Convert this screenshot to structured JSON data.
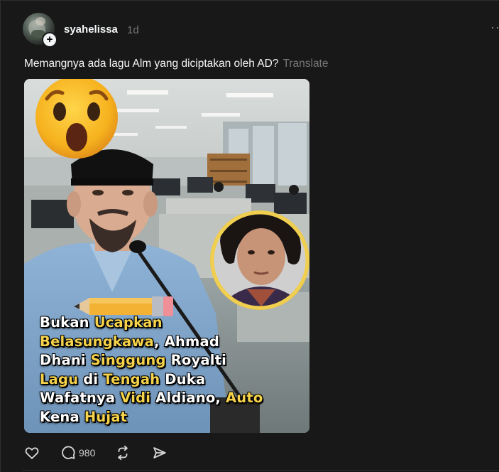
{
  "post": {
    "username": "syahelissa",
    "timestamp": "1d",
    "follow_icon": "plus",
    "more_icon": "ellipsis",
    "text": "Memangnya ada lagu Alm yang diciptakan oleh AD?",
    "translate_label": "Translate"
  },
  "media": {
    "headline": {
      "line1_a": "Bukan ",
      "line1_b": "Ucapkan",
      "line2_a": "Belasungkawa",
      "line2_b": ", Ahmad",
      "line3_a": "Dhani ",
      "line3_b": "Singgung",
      "line3_c": " Royalti",
      "line4_a": "Lagu",
      "line4_b": " di ",
      "line4_c": "Tengah",
      "line4_d": " Duka",
      "line5_a": "Wafatnya ",
      "line5_b": "Vidi",
      "line5_c": " Aldiano, ",
      "line5_d": "Auto",
      "line6_a": "Kena ",
      "line6_b": "Hujat"
    },
    "highlight_color": "#f6d34a"
  },
  "actions": {
    "like_icon": "heart",
    "reply_icon": "speech-bubble",
    "reply_count": "980",
    "repost_icon": "repost-arrows",
    "share_icon": "paper-plane"
  }
}
